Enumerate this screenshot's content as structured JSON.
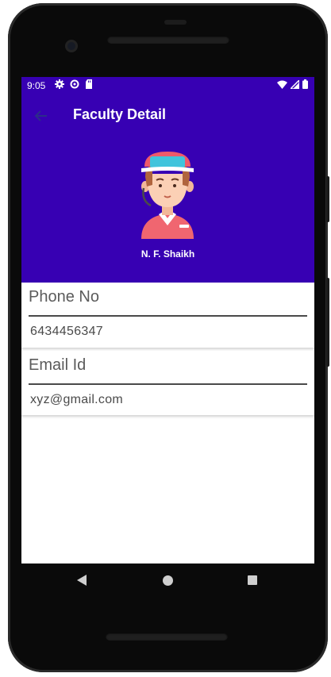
{
  "status_bar": {
    "time": "9:05",
    "left_icons": [
      "gear-icon",
      "data-saver-icon",
      "sd-card-icon"
    ],
    "right_icons": [
      "wifi-icon",
      "signal-icon",
      "battery-icon"
    ]
  },
  "app_bar": {
    "title": "Faculty Detail",
    "back_icon": "arrow-back-icon",
    "background": "#3700b3"
  },
  "profile": {
    "name": "N. F. Shaikh",
    "avatar": "user-avatar-with-cap"
  },
  "fields": [
    {
      "label": "Phone No",
      "value": "6434456347"
    },
    {
      "label": "Email Id",
      "value": "xyz@gmail.com"
    }
  ],
  "nav_bar": {
    "buttons": [
      "back-triangle-icon",
      "home-circle-icon",
      "recents-square-icon"
    ]
  }
}
